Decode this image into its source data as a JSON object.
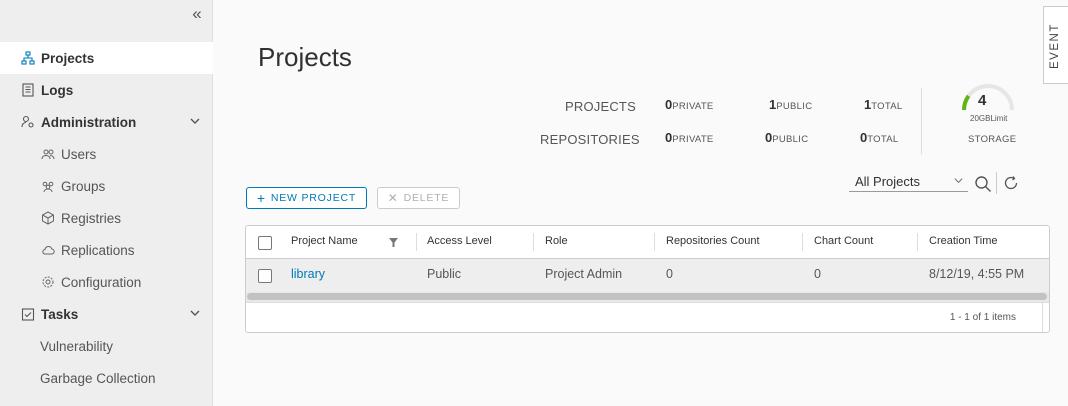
{
  "sidebar": {
    "collapse_icon": "double-chevron-left-icon",
    "items": [
      {
        "label": "Projects",
        "icon": "sitemap-icon",
        "active": true
      },
      {
        "label": "Logs",
        "icon": "document-icon"
      },
      {
        "label": "Administration",
        "icon": "user-settings-icon",
        "expanded": true
      },
      {
        "label": "Users",
        "icon": "users-icon"
      },
      {
        "label": "Groups",
        "icon": "groups-icon"
      },
      {
        "label": "Registries",
        "icon": "cube-icon"
      },
      {
        "label": "Replications",
        "icon": "cloud-sync-icon"
      },
      {
        "label": "Configuration",
        "icon": "gear-icon"
      },
      {
        "label": "Tasks",
        "icon": "tasks-icon",
        "expanded": true
      },
      {
        "label": "Vulnerability"
      },
      {
        "label": "Garbage Collection"
      }
    ]
  },
  "page": {
    "title": "Projects"
  },
  "event_tab": {
    "label": "EVENT"
  },
  "stats": {
    "projects_label": "PROJECTS",
    "repositories_label": "REPOSITORIES",
    "projects": {
      "private_num": "0",
      "private_label": "PRIVATE",
      "public_num": "1",
      "public_label": "PUBLIC",
      "total_num": "1",
      "total_label": "TOTAL"
    },
    "repositories": {
      "private_num": "0",
      "private_label": "PRIVATE",
      "public_num": "0",
      "public_label": "PUBLIC",
      "total_num": "0",
      "total_label": "TOTAL"
    },
    "storage": {
      "value": "4",
      "limit_text": "20GBLimit",
      "label": "STORAGE",
      "used_fraction": 0.2
    }
  },
  "toolbar": {
    "new_project_label": "NEW PROJECT",
    "delete_label": "DELETE",
    "filter_selected": "All Projects"
  },
  "table": {
    "columns": [
      "Project Name",
      "Access Level",
      "Role",
      "Repositories Count",
      "Chart Count",
      "Creation Time"
    ],
    "rows": [
      {
        "name": "library",
        "access": "Public",
        "role": "Project Admin",
        "repos": "0",
        "charts": "0",
        "created": "8/12/19, 4:55 PM"
      }
    ],
    "pagination": "1 - 1 of 1 items"
  },
  "colors": {
    "accent": "#0079b8",
    "gauge_green": "#60b515"
  }
}
